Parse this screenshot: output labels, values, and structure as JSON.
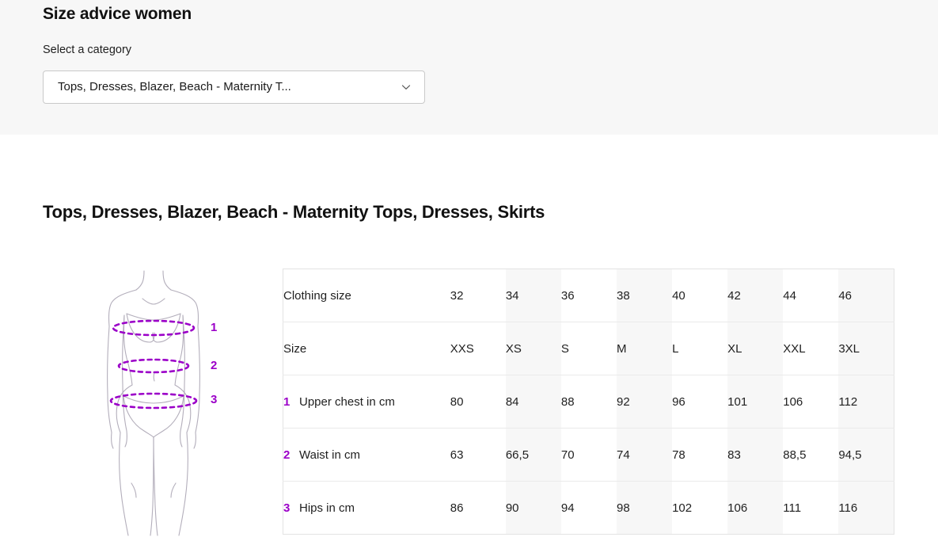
{
  "header": {
    "title": "Size advice women",
    "select_label": "Select a category",
    "select_value": "Tops, Dresses, Blazer, Beach - Maternity T...",
    "chevron_icon": "chevron-down-icon"
  },
  "section": {
    "heading": "Tops, Dresses, Blazer, Beach - Maternity Tops, Dresses, Skirts"
  },
  "illustration": {
    "name": "female-body-measurement-diagram",
    "outline_color": "#b3aebb",
    "measure_line_color": "#9B00C8",
    "markers": [
      {
        "number": "1",
        "measures": "upper chest"
      },
      {
        "number": "2",
        "measures": "waist"
      },
      {
        "number": "3",
        "measures": "hips"
      }
    ]
  },
  "colors": {
    "accent_purple": "#9B00C8",
    "panel_gray": "#f7f7f7",
    "shade_gray": "#f7f7f7",
    "border_gray": "#e3e3e3",
    "text_dark": "#1f1f1f"
  },
  "chart_data": {
    "type": "table",
    "title": "Tops, Dresses, Blazer, Beach - Maternity Tops, Dresses, Skirts",
    "columns": [
      "",
      "32",
      "34",
      "36",
      "38",
      "40",
      "42",
      "44",
      "46"
    ],
    "shaded_columns": [
      1,
      3,
      5,
      7
    ],
    "rows": [
      {
        "marker": "",
        "label": "Clothing size",
        "values": [
          "32",
          "34",
          "36",
          "38",
          "40",
          "42",
          "44",
          "46"
        ]
      },
      {
        "marker": "",
        "label": "Size",
        "values": [
          "XXS",
          "XS",
          "S",
          "M",
          "L",
          "XL",
          "XXL",
          "3XL"
        ]
      },
      {
        "marker": "1",
        "label": "Upper chest in cm",
        "values": [
          "80",
          "84",
          "88",
          "92",
          "96",
          "101",
          "106",
          "112"
        ]
      },
      {
        "marker": "2",
        "label": "Waist in cm",
        "values": [
          "63",
          "66,5",
          "70",
          "74",
          "78",
          "83",
          "88,5",
          "94,5"
        ]
      },
      {
        "marker": "3",
        "label": "Hips in cm",
        "values": [
          "86",
          "90",
          "94",
          "98",
          "102",
          "106",
          "111",
          "116"
        ]
      }
    ]
  }
}
